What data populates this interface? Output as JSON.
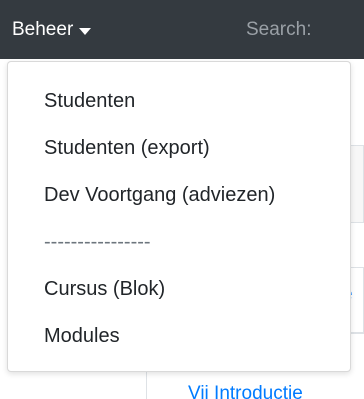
{
  "navbar": {
    "menu_label": "Beheer",
    "search_label": "Search:"
  },
  "dropdown": {
    "items": [
      {
        "label": "Studenten"
      },
      {
        "label": "Studenten (export)"
      },
      {
        "label": "Dev Voortgang (adviezen)"
      },
      {
        "label": "----------------"
      },
      {
        "label": "Cursus (Blok)"
      },
      {
        "label": "Modules"
      }
    ]
  },
  "background": {
    "link_fragment": "e",
    "bottom_link": "Vij Introductie"
  },
  "colors": {
    "navbar_bg": "#343a40",
    "link": "#007bff",
    "text": "#212529"
  }
}
